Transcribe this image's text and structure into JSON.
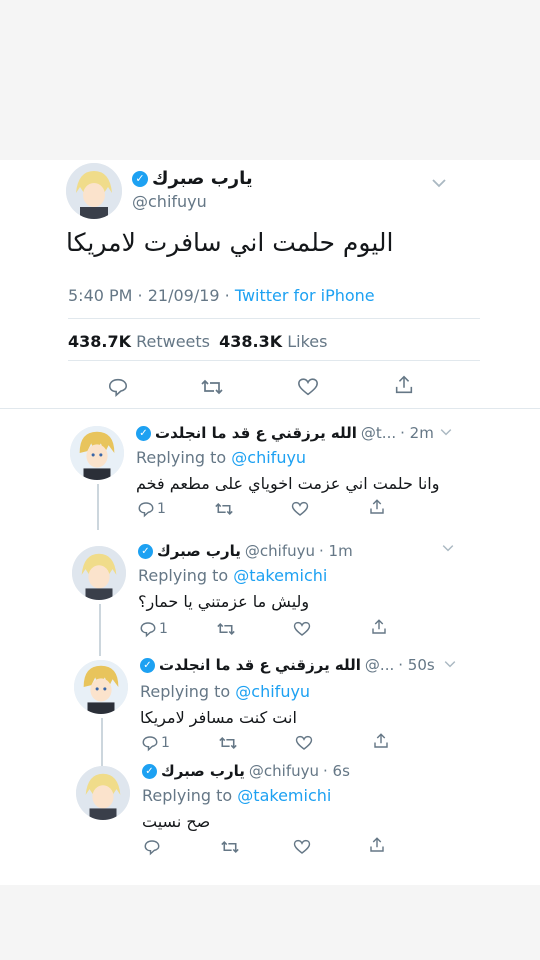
{
  "colors": {
    "accent": "#1da1f2",
    "muted": "#657786",
    "text": "#14171a",
    "divider": "#e1e8ed"
  },
  "main_tweet": {
    "name": "يارب صبرك",
    "handle": "@chifuyu",
    "text": "اليوم حلمت اني سافرت لامريكا",
    "time": "5:40 PM · 21/09/19 · ",
    "source": "Twitter for iPhone",
    "retweets_count": "438.7K",
    "retweets_label": "Retweets",
    "likes_count": "438.3K",
    "likes_label": "Likes",
    "icons": [
      "reply-icon",
      "retweet-icon",
      "like-icon",
      "share-icon",
      "verified-icon",
      "chevron-down-icon"
    ]
  },
  "replies": [
    {
      "name": "الله يرزقني ع قد ما انجلدت",
      "handle": "@t...",
      "time": "· 2m",
      "replying_label": "Replying to",
      "replying_to": "@chifuyu",
      "text": "وانا حلمت اني عزمت اخوياي على مطعم فخم",
      "reply_count": "1"
    },
    {
      "name": "يارب صبرك",
      "handle": "@chifuyu",
      "time": "· 1m",
      "replying_label": "Replying to",
      "replying_to": "@takemichi",
      "text": "وليش ما عزمتني يا حمار؟",
      "reply_count": "1"
    },
    {
      "name": "الله يرزقني ع قد ما انجلدت",
      "handle": "@...",
      "time": "· 50s",
      "replying_label": "Replying to",
      "replying_to": "@chifuyu",
      "text": "انت كنت مسافر لامريكا",
      "reply_count": "1"
    },
    {
      "name": "يارب صبرك",
      "handle": "@chifuyu",
      "time": "· 6s",
      "replying_label": "Replying to",
      "replying_to": "@takemichi",
      "text": "صح نسيت",
      "reply_count": ""
    }
  ]
}
